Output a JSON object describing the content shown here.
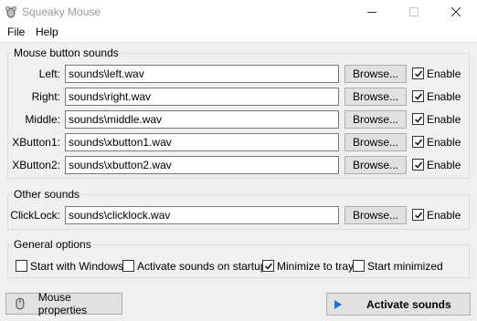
{
  "window": {
    "title": "Squeaky Mouse",
    "icon": "mouse-icon"
  },
  "menu": [
    "File",
    "Help"
  ],
  "mouse_button_sounds": {
    "title": "Mouse button sounds",
    "rows": [
      {
        "label": "Left:",
        "value": "sounds\\left.wav",
        "browse": "Browse...",
        "enable": "Enable",
        "enabled": true
      },
      {
        "label": "Right:",
        "value": "sounds\\right.wav",
        "browse": "Browse...",
        "enable": "Enable",
        "enabled": true
      },
      {
        "label": "Middle:",
        "value": "sounds\\middle.wav",
        "browse": "Browse...",
        "enable": "Enable",
        "enabled": true
      },
      {
        "label": "XButton1:",
        "value": "sounds\\xbutton1.wav",
        "browse": "Browse...",
        "enable": "Enable",
        "enabled": true
      },
      {
        "label": "XButton2:",
        "value": "sounds\\xbutton2.wav",
        "browse": "Browse...",
        "enable": "Enable",
        "enabled": true
      }
    ]
  },
  "other_sounds": {
    "title": "Other sounds",
    "rows": [
      {
        "label": "ClickLock:",
        "value": "sounds\\clicklock.wav",
        "browse": "Browse...",
        "enable": "Enable",
        "enabled": true
      }
    ]
  },
  "general_options": {
    "title": "General options",
    "options": [
      {
        "label": "Start with Windows",
        "checked": false
      },
      {
        "label": "Activate sounds on startup",
        "checked": false
      },
      {
        "label": "Minimize to tray",
        "checked": true
      },
      {
        "label": "Start minimized",
        "checked": false
      }
    ]
  },
  "footer": {
    "mouse_properties": "Mouse properties",
    "activate": "Activate sounds"
  },
  "colors": {
    "accent_play": "#1e73d6",
    "button_face": "#e1e1e1",
    "client_bg": "#f0f0f0"
  }
}
